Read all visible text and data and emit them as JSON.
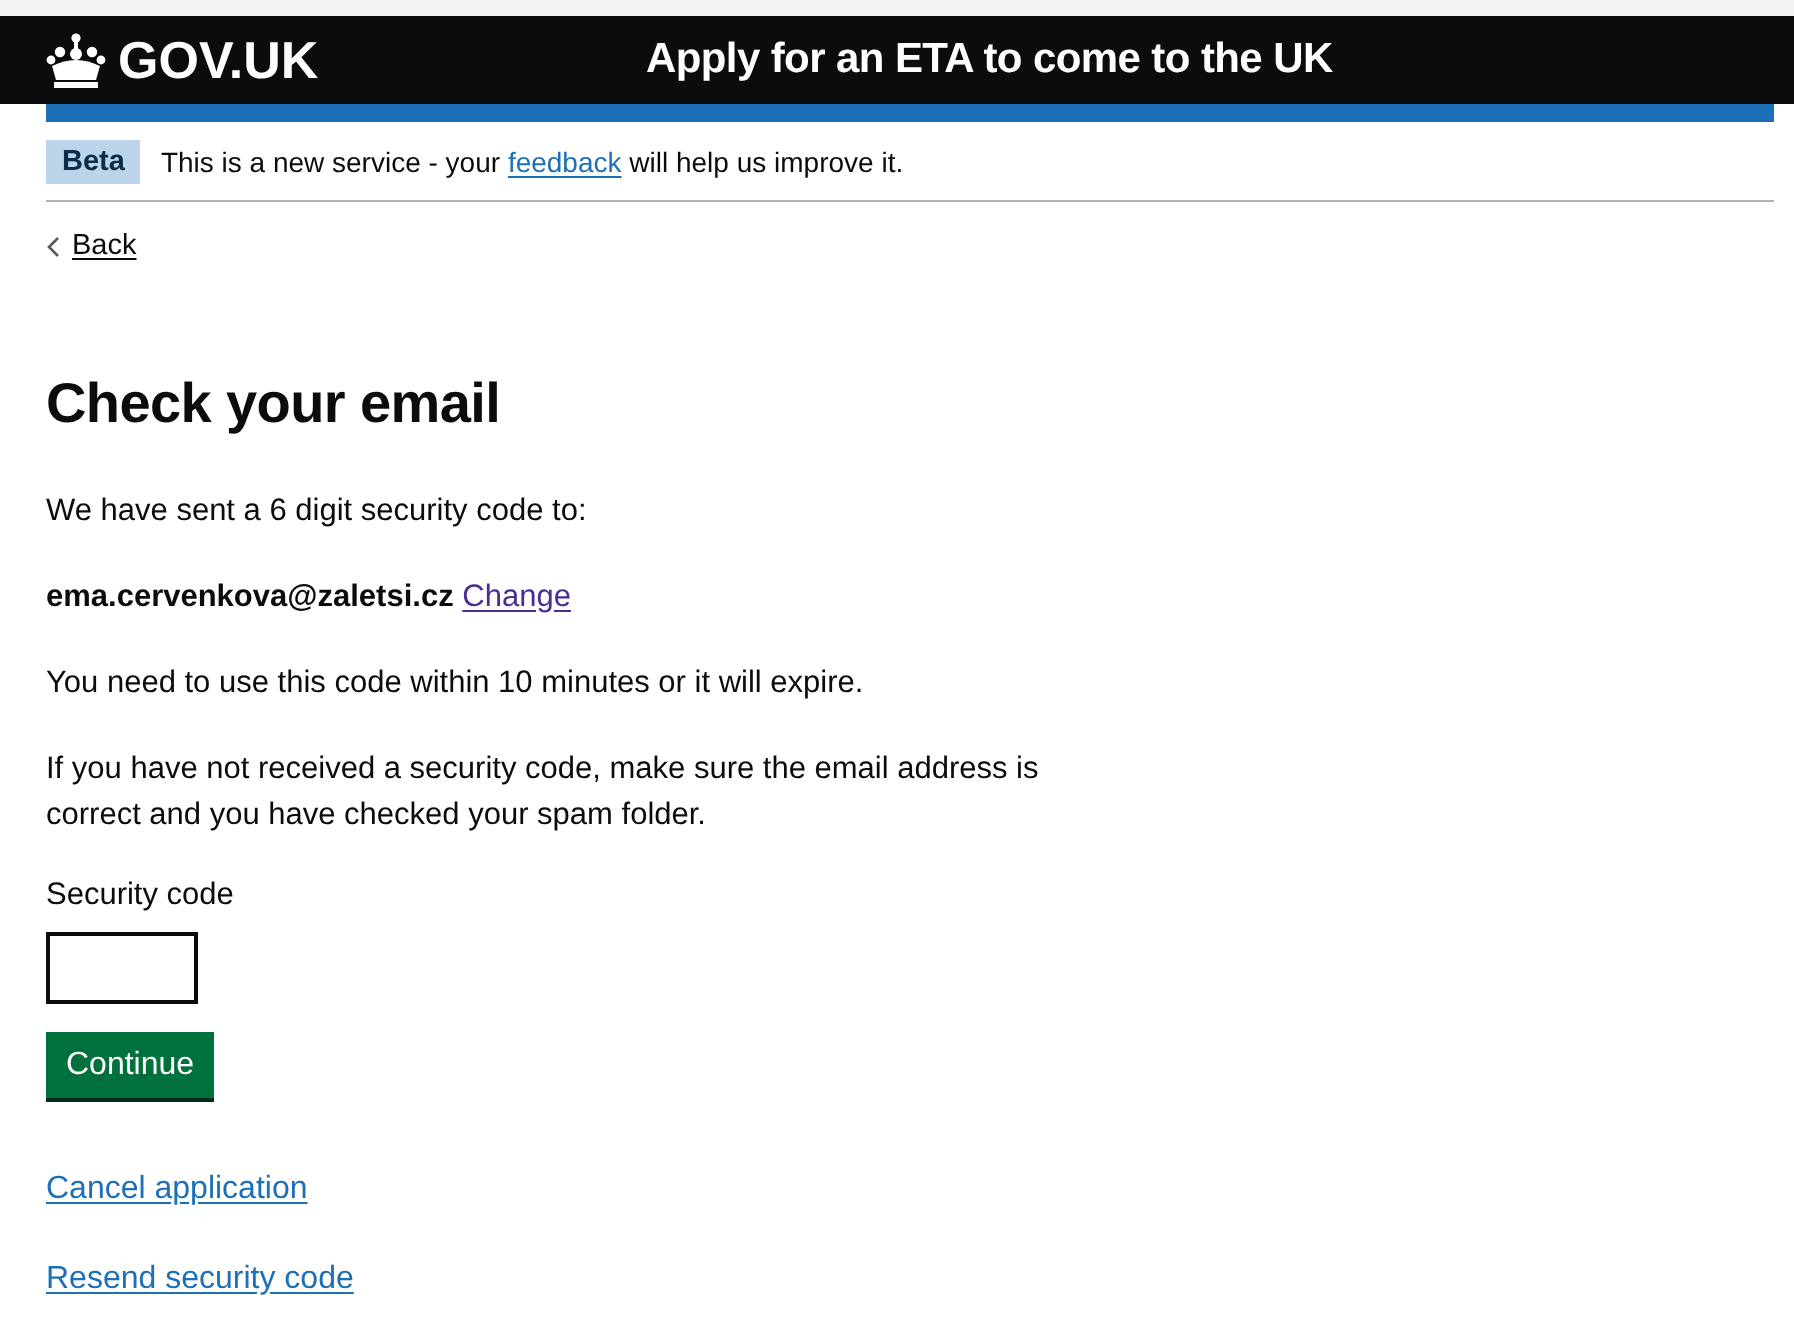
{
  "header": {
    "logo": "GOV.UK",
    "service_name": "Apply for an ETA to come to the UK"
  },
  "phase_banner": {
    "tag": "Beta",
    "text_before": "This is a new service - your ",
    "link": {
      "label": "feedback",
      "visited": false
    },
    "text_after": " will help us improve it."
  },
  "back_link": {
    "label": "Back"
  },
  "heading": "Check your email",
  "intro": "We have sent a 6 digit security code to:",
  "email": "ema.cervenkova@zaletsi.cz",
  "change_link": {
    "label": "Change",
    "visited": true
  },
  "paragraphs": [
    "You need to use this code within 10 minutes or it will expire.",
    "If you have not received a security code, make sure the email address is correct and you have checked your spam folder."
  ],
  "security_code": {
    "label": "Security code"
  },
  "continue_button": "Continue",
  "links": [
    {
      "label": "Cancel application",
      "visited": false
    },
    {
      "label": "Resend security code",
      "visited": false
    }
  ]
}
